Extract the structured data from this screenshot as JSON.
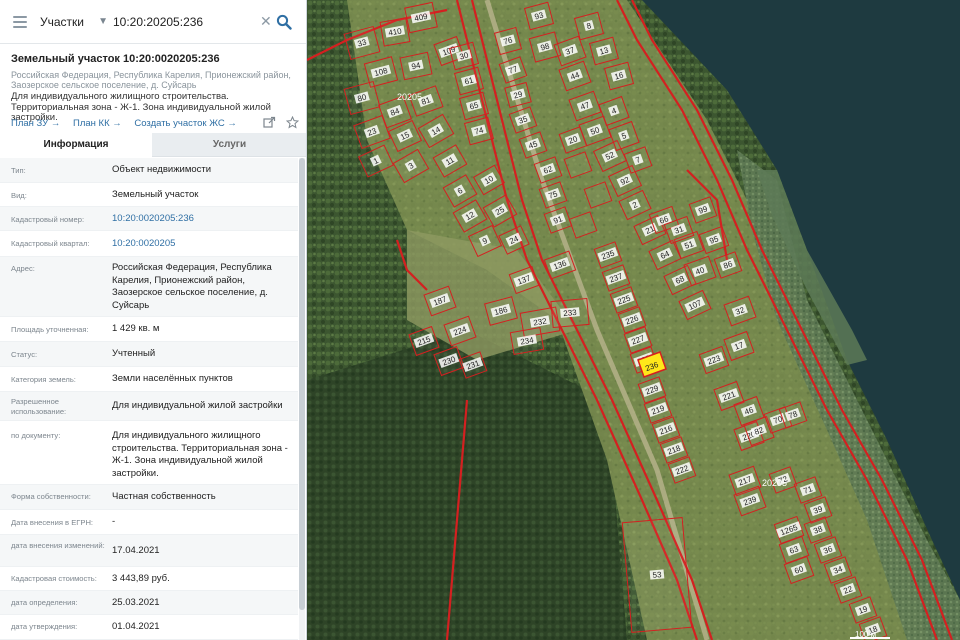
{
  "search": {
    "type_label": "Участки",
    "query": "10:20:20205:236"
  },
  "object": {
    "title": "Земельный участок 10:20:0020205:236",
    "address": "Российская Федерация, Республика Карелия, Прионежский район, Заозерское сельское поселение, д. Суйсарь",
    "purpose": "Для индивидуального жилищного строительства. Территориальная зона - Ж-1. Зона индивидуальной жилой застройки.",
    "links": [
      "План ЗУ →",
      "План КК →",
      "Создать участок ЖС →"
    ]
  },
  "tabs": {
    "info": "Информация",
    "services": "Услуги"
  },
  "attributes": [
    {
      "label": "Тип:",
      "value": "Объект недвижимости"
    },
    {
      "label": "Вид:",
      "value": "Земельный участок"
    },
    {
      "label": "Кадастровый номер:",
      "value": "10:20:0020205:236"
    },
    {
      "label": "Кадастровый квартал:",
      "value": "10:20:0020205"
    },
    {
      "label": "Адрес:",
      "value": "Российская Федерация, Республика Карелия, Прионежский район, Заозерское сельское поселение, д. Суйсарь"
    },
    {
      "label": "Площадь уточненная:",
      "value": "1 429 кв. м"
    },
    {
      "label": "Статус:",
      "value": "Учтенный"
    },
    {
      "label": "Категория земель:",
      "value": "Земли населённых пунктов"
    },
    {
      "label": "Разрешенное использование:",
      "value": "Для индивидуальной жилой застройки"
    },
    {
      "label": "по документу:",
      "value": "Для индивидуального жилищного строительства. Территориальная зона - Ж-1. Зона индивидуальной жилой застройки."
    },
    {
      "label": "Форма собственности:",
      "value": "Частная собственность"
    },
    {
      "label": "Дата внесения в ЕГРН:",
      "value": "-"
    },
    {
      "label": "дата внесения изменений:",
      "value": "17.04.2021"
    },
    {
      "label": "Кадастровая стоимость:",
      "value": "3 443,89 руб."
    },
    {
      "label": "дата определения:",
      "value": "25.03.2021"
    },
    {
      "label": "дата утверждения:",
      "value": "01.04.2021"
    }
  ],
  "map": {
    "quarter_labels": [
      "20205",
      "20205"
    ],
    "selected_parcel": "236",
    "scale": "100 м",
    "parcel_numbers": [
      "33",
      "410",
      "409",
      "109",
      "108",
      "94",
      "80",
      "84",
      "81",
      "23",
      "15",
      "14",
      "1",
      "3",
      "11",
      "6",
      "10",
      "12",
      "25",
      "9",
      "24",
      "30",
      "61",
      "65",
      "74",
      "76",
      "77",
      "29",
      "35",
      "45",
      "62",
      "75",
      "91",
      "93",
      "98",
      "37",
      "44",
      "47",
      "50",
      "52",
      "92",
      "2",
      "21",
      "64",
      "68",
      "107",
      "136",
      "137",
      "186",
      "187",
      "224",
      "215",
      "230",
      "231",
      "232",
      "233",
      "234",
      "235",
      "237",
      "225",
      "226",
      "227",
      "228",
      "229",
      "219",
      "216",
      "218",
      "222",
      "223",
      "221",
      "220",
      "217",
      "239",
      "1265",
      "63",
      "60",
      "53",
      "51",
      "40",
      "66",
      "31",
      "99",
      "95",
      "86",
      "32",
      "17",
      "46",
      "82",
      "70",
      "78",
      "72",
      "71",
      "39",
      "38",
      "36",
      "34",
      "22",
      "19",
      "18",
      "4",
      "5",
      "7",
      "8",
      "13",
      "16",
      "20"
    ]
  },
  "colors": {
    "parcel_line": "#d42020",
    "selected_fill": "#ffe81a",
    "link": "#2f6fa4",
    "water": "#1e3a40",
    "forest": "#3f5a2e",
    "meadow": "#8a9a5a"
  }
}
